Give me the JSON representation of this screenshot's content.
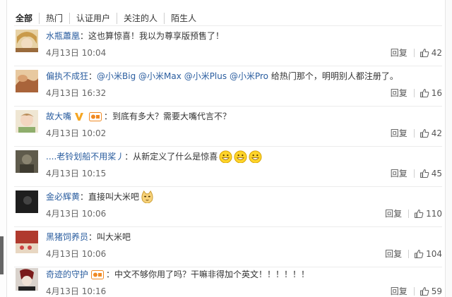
{
  "tabs": [
    "全部",
    "热门",
    "认证用户",
    "关注的人",
    "陌生人"
  ],
  "reply_label": "回复",
  "comments": [
    {
      "user": "水瓶蕭凰",
      "text": "这也算惊喜！我以为尊享版预售了！",
      "time": "4月13日 10:04",
      "likes": "42",
      "avatar_color": "#c9a36a"
    },
    {
      "user": "偏执不成狂",
      "text": "@小米Big @小米Max @小米Plus @小米Pro 给热门那个，明明别人都注册了。",
      "mentions": [
        "@小米Big",
        "@小米Max",
        "@小米Plus",
        "@小米Pro"
      ],
      "text_after": " 给热门那个，明明别人都注册了。",
      "time": "4月13日 16:32",
      "likes": "16",
      "avatar_color": "#b77a4e"
    },
    {
      "user": "故大嘴",
      "text": "到底有多大？需要大嘴代言不？",
      "time": "4月13日 10:02",
      "likes": "42",
      "avatar_color": "#d8c9a8",
      "badge": "v"
    },
    {
      "user": "....老铃划船不用桨丿",
      "text": "从新定义了什么是惊喜",
      "time": "4月13日 10:15",
      "likes": "45",
      "avatar_color": "#6d6a5a",
      "emoji_count": 3
    },
    {
      "user": "金必辉黄",
      "text": "直接叫大米吧",
      "time": "4月13日 10:06",
      "likes": "110",
      "avatar_color": "#2b2b2b",
      "emoji": "dog"
    },
    {
      "user": "黑猪饲养员",
      "text": "叫大米吧",
      "time": "4月13日 10:06",
      "likes": "104",
      "avatar_color": "#9a3a2f"
    },
    {
      "user": "奇迹的守护",
      "text": "中文不够你用了吗？干嘛非得加个英文！！！！！！",
      "time": "4月13日 10:16",
      "likes": "59",
      "avatar_color": "#7b1e1e",
      "badge": "tag"
    }
  ]
}
